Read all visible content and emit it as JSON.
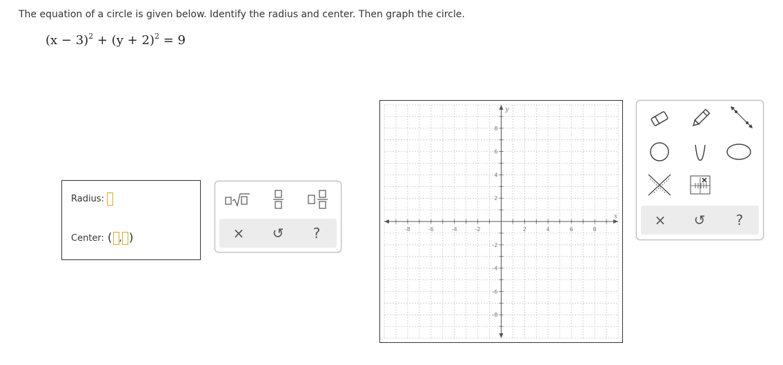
{
  "prompt": "The equation of a circle is given below. Identify the radius and center. Then graph the circle.",
  "equation": {
    "part1": "(x − 3)",
    "exp1": "2",
    "plus": "+",
    "part2": "(y + 2)",
    "exp2": "2",
    "rhs": "= 9"
  },
  "answer": {
    "radius_label": "Radius:",
    "center_label": "Center:",
    "open_paren": "(",
    "comma": ",",
    "close_paren": ")"
  },
  "math_palette": {
    "buttons": [
      "sqrt-template",
      "fraction-template",
      "mixed-number-template"
    ],
    "strip": {
      "clear": "×",
      "undo": "↺",
      "help": "?"
    }
  },
  "graph": {
    "x_axis_label": "x",
    "y_axis_label": "y",
    "xmin": -10,
    "xmax": 10,
    "ymin": -10,
    "ymax": 10,
    "x_ticks": [
      "-8",
      "-6",
      "-4",
      "-2",
      "2",
      "4",
      "6",
      "8"
    ],
    "y_ticks": [
      "8",
      "6",
      "4",
      "2",
      "-2",
      "-4",
      "-6",
      "-8"
    ],
    "grid": true
  },
  "tool_palette": {
    "tools": [
      "eraser-tool",
      "pencil-tool",
      "line-tool",
      "circle-tool",
      "parabola-tool",
      "ellipse-tool",
      "no-solution-tool",
      "point-grid-tool"
    ],
    "strip": {
      "clear": "×",
      "undo": "↺",
      "help": "?"
    }
  },
  "colors": {
    "accent_yellow": "#d8a62a",
    "strip_bg": "#ececec",
    "text": "#333333"
  }
}
